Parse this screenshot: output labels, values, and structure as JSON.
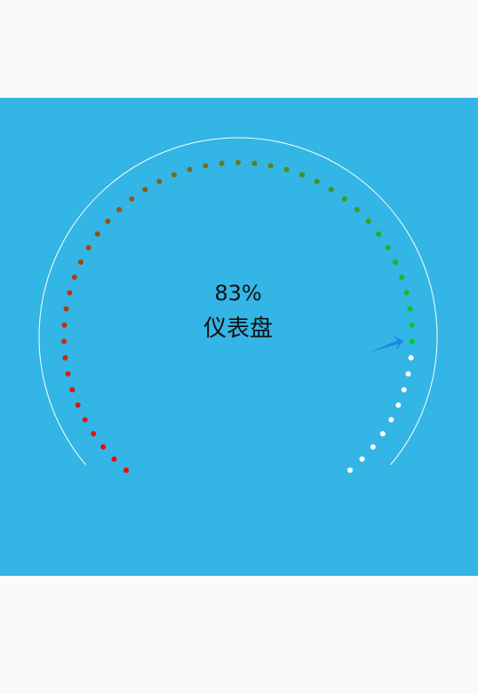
{
  "gauge": {
    "percent_label": "83%",
    "title": "仪表盘",
    "value_percent": 83,
    "colors": {
      "background": "#33B5E5",
      "outer_arc": "#FFFFFF",
      "inactive_dot": "#FFFFFF",
      "start_dot": "#FF0000",
      "end_dot": "#00CC22",
      "arrow": "#1E88E5"
    }
  }
}
